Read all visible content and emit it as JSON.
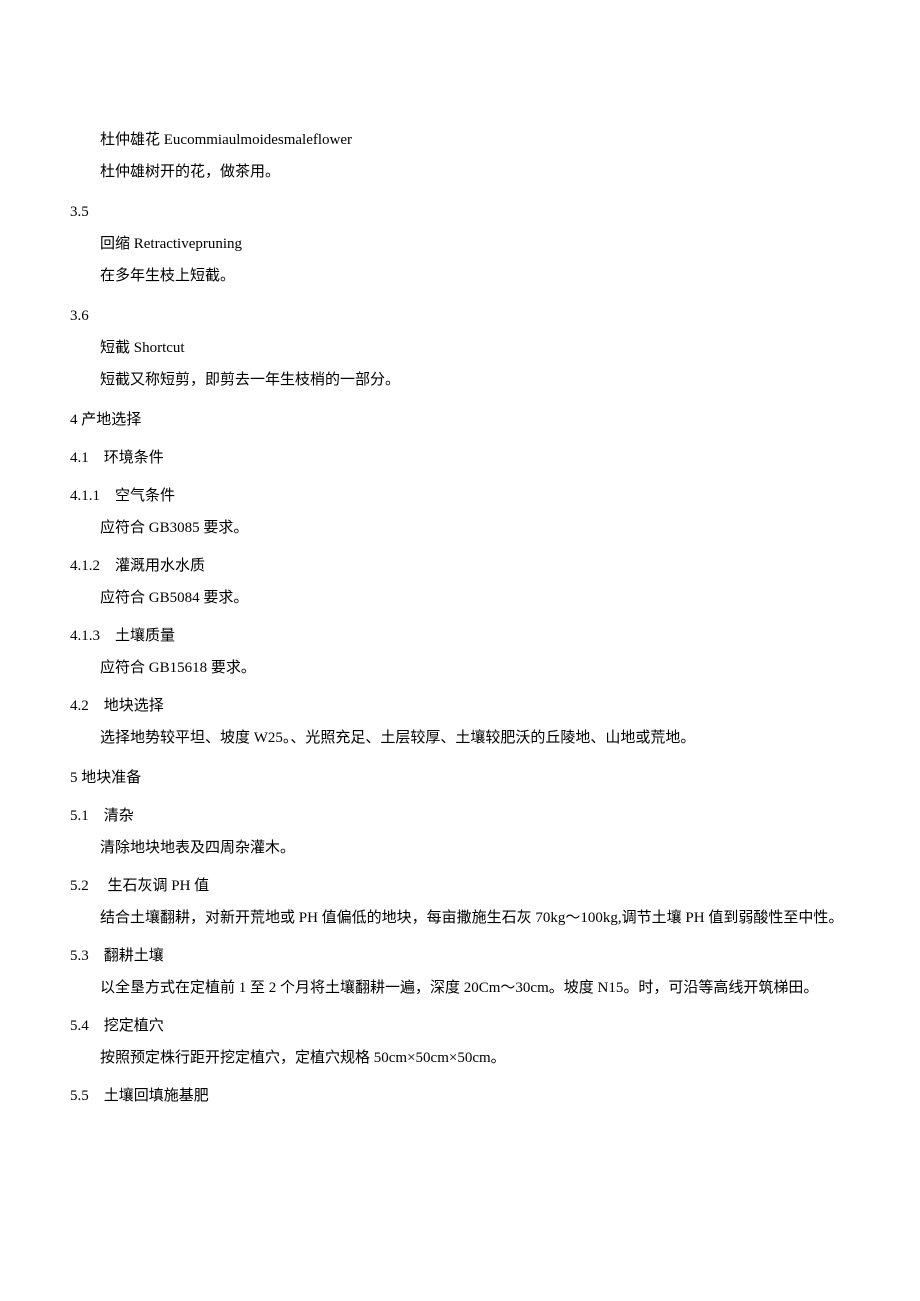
{
  "s3_4": {
    "term": "杜仲雄花 Eucommiaulmoidesmaleflower",
    "definition": "杜仲雄树开的花，做茶用。"
  },
  "s3_5": {
    "number": "3.5",
    "term": "回缩 Retractivepruning",
    "definition": "在多年生枝上短截。"
  },
  "s3_6": {
    "number": "3.6",
    "term": "短截 Shortcut",
    "definition": "短截又称短剪，即剪去一年生枝梢的一部分。"
  },
  "s4": {
    "title": "4 产地选择"
  },
  "s4_1": {
    "title": "4.1 环境条件"
  },
  "s4_1_1": {
    "title": "4.1.1 空气条件",
    "content": "应符合 GB3085 要求。"
  },
  "s4_1_2": {
    "title": "4.1.2 灌溉用水水质",
    "content": "应符合 GB5084 要求。"
  },
  "s4_1_3": {
    "title": "4.1.3 土壤质量",
    "content": "应符合 GB15618 要求。"
  },
  "s4_2": {
    "title": "4.2 地块选择",
    "content": "选择地势较平坦、坡度 W25。、光照充足、土层较厚、土壤较肥沃的丘陵地、山地或荒地。"
  },
  "s5": {
    "title": "5 地块准备"
  },
  "s5_1": {
    "title": "5.1 清杂",
    "content": "清除地块地表及四周杂灌木。"
  },
  "s5_2": {
    "title": "5.2  生石灰调 PH 值",
    "content": "结合土壤翻耕，对新开荒地或 PH 值偏低的地块，每亩撒施生石灰 70kg～100kg,调节土壤 PH 值到弱酸性至中性。"
  },
  "s5_3": {
    "title": "5.3 翻耕土壤",
    "content": "以全垦方式在定植前 1 至 2 个月将土壤翻耕一遍，深度 20Cm～30cm。坡度 N15。时，可沿等高线开筑梯田。"
  },
  "s5_4": {
    "title": "5.4 挖定植穴",
    "content": "按照预定株行距开挖定植穴，定植穴规格 50cm×50cm×50cm。"
  },
  "s5_5": {
    "title": "5.5 土壤回填施基肥"
  }
}
